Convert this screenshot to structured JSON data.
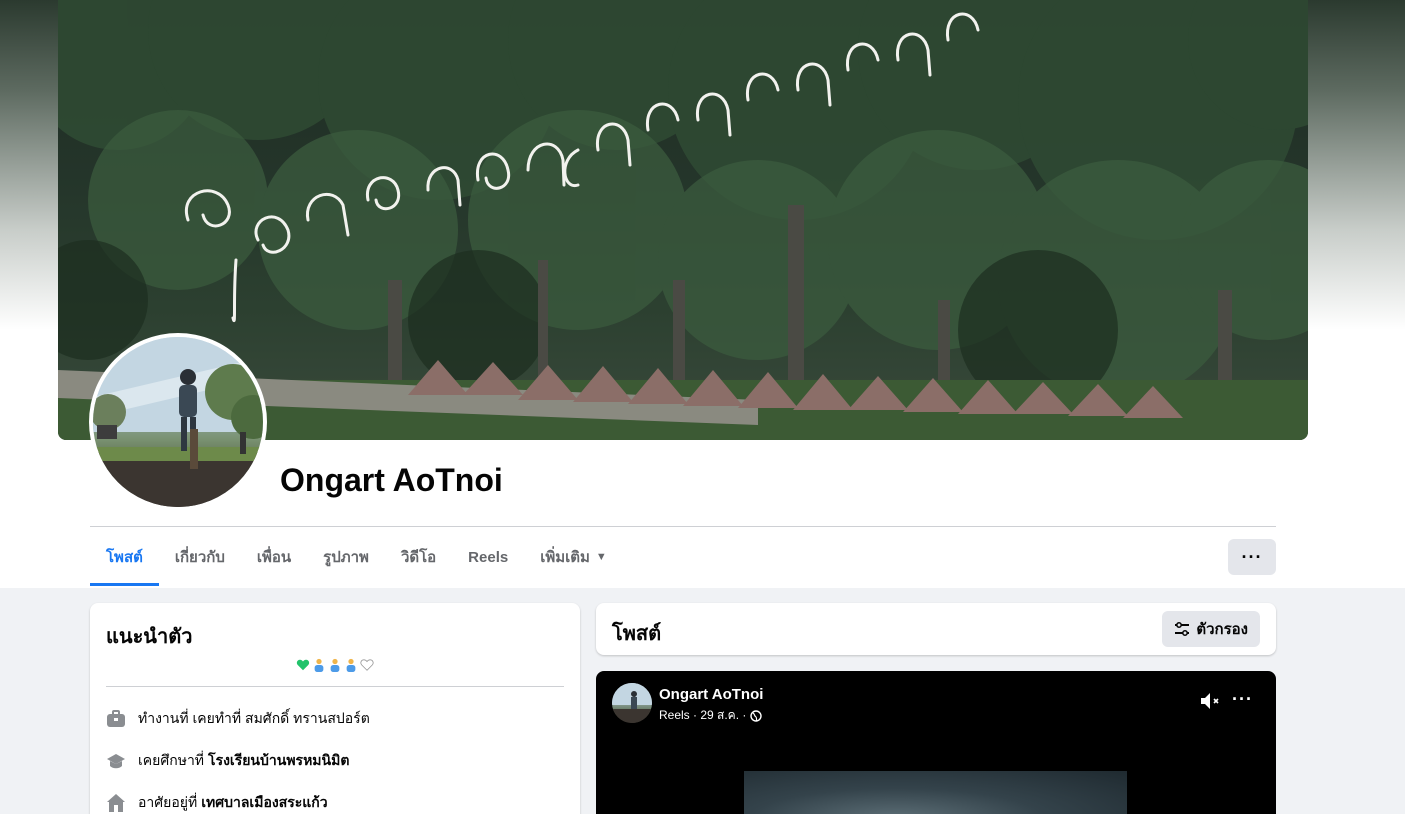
{
  "profile": {
    "name": "Ongart AoTnoi"
  },
  "tabs": [
    {
      "label": "โพสต์",
      "active": true
    },
    {
      "label": "เกี่ยวกับ",
      "active": false
    },
    {
      "label": "เพื่อน",
      "active": false
    },
    {
      "label": "รูปภาพ",
      "active": false
    },
    {
      "label": "วิดีโอ",
      "active": false
    },
    {
      "label": "Reels",
      "active": false
    },
    {
      "label": "เพิ่มเติม",
      "active": false
    }
  ],
  "more_button_label": "···",
  "intro": {
    "title": "แนะนำตัว",
    "bio_icons": [
      "green-heart-icon",
      "person-icon",
      "person-icon",
      "person-icon",
      "white-heart-icon"
    ],
    "work": {
      "prefix": "ทำงานที่ เคยทำที่ สมศักดิ์ ทรานสปอร์ต",
      "value": ""
    },
    "education": {
      "prefix": "เคยศึกษาที่",
      "value": "โรงเรียนบ้านพรหมนิมิต"
    },
    "lives": {
      "prefix": "อาศัยอยู่ที่",
      "value": "เทศบาลเมืองสระแก้ว"
    }
  },
  "posts_header": {
    "title": "โพสต์",
    "filter_label": "ตัวกรอง"
  },
  "reel_post": {
    "author": "Ongart AoTnoi",
    "meta": "Reels · 29 ส.ค. ·",
    "dots": "···"
  },
  "colors": {
    "accent": "#1877f2",
    "page_bg": "#f0f2f5",
    "card_bg": "#ffffff",
    "button_bg": "#e4e6eb",
    "text_secondary": "#65676b"
  }
}
